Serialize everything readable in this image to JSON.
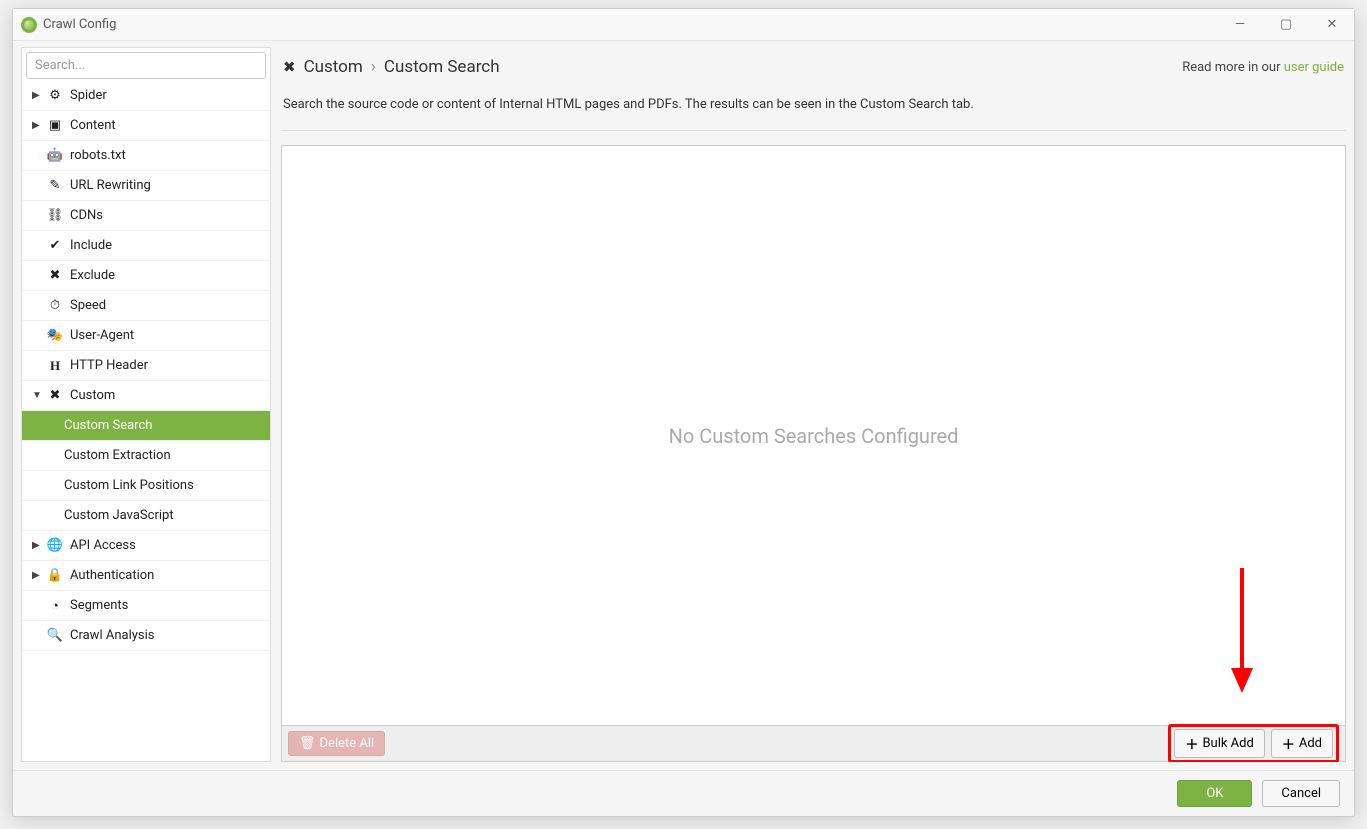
{
  "window": {
    "title": "Crawl Config"
  },
  "search": {
    "placeholder": "Search..."
  },
  "sidebar": {
    "items": [
      {
        "label": "Spider",
        "expandable": true,
        "expanded": false,
        "icon": "gear"
      },
      {
        "label": "Content",
        "expandable": true,
        "expanded": false,
        "icon": "layout"
      },
      {
        "label": "robots.txt",
        "icon": "robot"
      },
      {
        "label": "URL Rewriting",
        "icon": "edit"
      },
      {
        "label": "CDNs",
        "icon": "network"
      },
      {
        "label": "Include",
        "icon": "check-circle"
      },
      {
        "label": "Exclude",
        "icon": "x-circle"
      },
      {
        "label": "Speed",
        "icon": "gauge"
      },
      {
        "label": "User-Agent",
        "icon": "user-agent"
      },
      {
        "label": "HTTP Header",
        "icon": "header"
      },
      {
        "label": "Custom",
        "expandable": true,
        "expanded": true,
        "icon": "tools"
      },
      {
        "label": "Custom Search",
        "child": true,
        "selected": true
      },
      {
        "label": "Custom Extraction",
        "child": true
      },
      {
        "label": "Custom Link Positions",
        "child": true
      },
      {
        "label": "Custom JavaScript",
        "child": true
      },
      {
        "label": "API Access",
        "expandable": true,
        "expanded": false,
        "icon": "globe"
      },
      {
        "label": "Authentication",
        "expandable": true,
        "expanded": false,
        "icon": "lock"
      },
      {
        "label": "Segments",
        "icon": "pie"
      },
      {
        "label": "Crawl Analysis",
        "icon": "search"
      }
    ]
  },
  "breadcrumb": {
    "section": "Custom",
    "page": "Custom Search"
  },
  "readmore": {
    "prefix": "Read more in our ",
    "link": "user guide"
  },
  "description": "Search the source code or content of Internal HTML pages and PDFs. The results can be seen in the Custom Search tab.",
  "canvas": {
    "empty_message": "No Custom Searches Configured"
  },
  "actions": {
    "delete_all": "Delete All",
    "bulk_add": "Bulk Add",
    "add": "Add"
  },
  "footer": {
    "ok": "OK",
    "cancel": "Cancel"
  }
}
